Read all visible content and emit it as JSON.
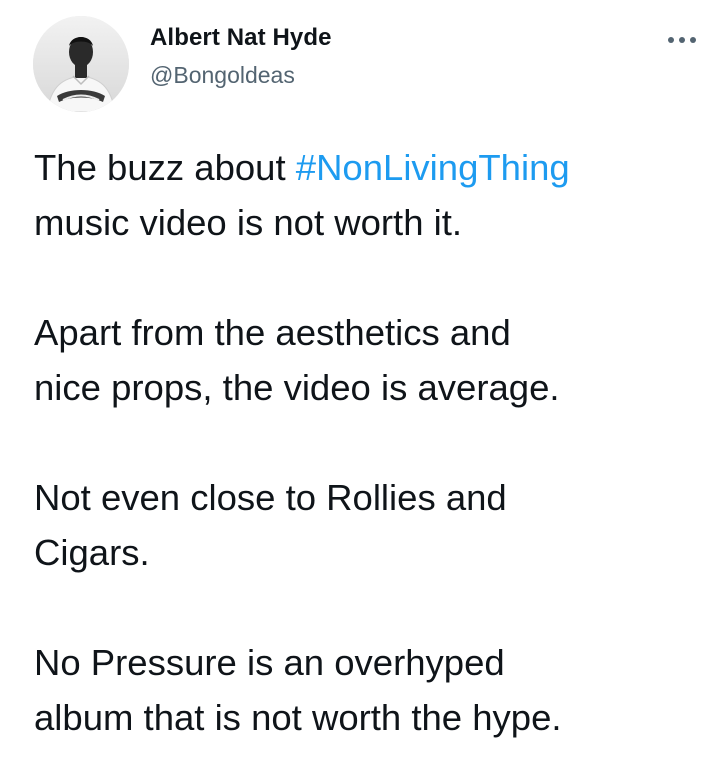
{
  "author": {
    "display_name": "Albert Nat Hyde",
    "handle": "@Bongoldeas"
  },
  "icons": {
    "more": "more-horizontal-icon",
    "avatar": "profile-avatar"
  },
  "tweet": {
    "p1": {
      "prefix": "The buzz about ",
      "hashtag": "#NonLivingThing",
      "line2": "music video is not worth it."
    },
    "p2": {
      "line1": "Apart from the aesthetics and",
      "line2": "nice props, the video is average."
    },
    "p3": {
      "line1": "Not even close to Rollies and",
      "line2": "Cigars."
    },
    "p4": {
      "line1": "No Pressure is an overhyped",
      "line2": "album that is not worth the hype."
    }
  },
  "colors": {
    "text": "#0f1419",
    "secondary": "#536471",
    "link": "#1d9bf0",
    "background": "#ffffff"
  }
}
